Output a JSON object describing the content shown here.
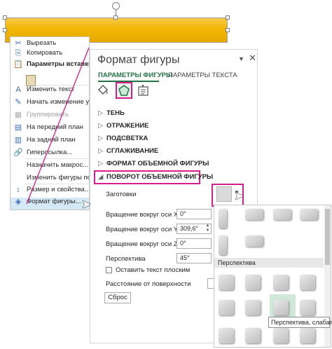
{
  "context_menu": {
    "items": [
      {
        "label": "Вырезать",
        "icon": "scissors-icon",
        "glyph": "✂",
        "disabled": false
      },
      {
        "label": "Копировать",
        "icon": "copy-icon",
        "glyph": "⎘",
        "disabled": false
      },
      {
        "label": "Параметры вставки:",
        "icon": "paste-icon",
        "glyph": "📋",
        "disabled": false,
        "bold": true
      },
      {
        "label": "Изменить текст",
        "icon": "edit-text-icon",
        "glyph": "A",
        "disabled": false
      },
      {
        "label": "Начать изменение узлов",
        "icon": "edit-points-icon",
        "glyph": "✎",
        "disabled": false
      },
      {
        "label": "Группировать",
        "icon": "group-icon",
        "glyph": "▦",
        "disabled": true
      },
      {
        "label": "На передний план",
        "icon": "bring-forward-icon",
        "glyph": "▤",
        "disabled": false
      },
      {
        "label": "На задний план",
        "icon": "send-backward-icon",
        "glyph": "▥",
        "disabled": false
      },
      {
        "label": "Гиперссылка...",
        "icon": "hyperlink-icon",
        "glyph": "🔗",
        "disabled": false
      },
      {
        "label": "Назначить макрос...",
        "icon": "",
        "glyph": "",
        "disabled": false
      },
      {
        "label": "Изменить фигуры по умолчанию",
        "icon": "",
        "glyph": "",
        "disabled": false
      },
      {
        "label": "Размер и свойства...",
        "icon": "size-properties-icon",
        "glyph": "↕",
        "disabled": false
      },
      {
        "label": "Формат фигуры...",
        "icon": "format-shape-icon",
        "glyph": "◈",
        "disabled": false
      }
    ]
  },
  "panel": {
    "title": "Формат фигуры",
    "tabs": [
      "ПАРАМЕТРЫ ФИГУРЫ",
      "ПАРАМЕТРЫ ТЕКСТА"
    ],
    "sections": [
      "ТЕНЬ",
      "ОТРАЖЕНИЕ",
      "ПОДСВЕТКА",
      "СГЛАЖИВАНИЕ",
      "ФОРМАТ ОБЪЕМНОЙ ФИГУРЫ",
      "ПОВОРОТ ОБЪЕМНОЙ ФИГУРЫ"
    ],
    "presets_label": "Заготовки",
    "rotation": {
      "x_label": "Вращение вокруг оси X",
      "x_value": "0°",
      "y_label": "Вращение вокруг оси Y",
      "y_value": "309,6°",
      "z_label": "Вращение вокруг оси Z",
      "z_value": "0°",
      "perspective_label": "Перспектива",
      "perspective_value": "45°"
    },
    "keep_flat_label": "Оставить текст плоским",
    "distance_label": "Расстояние от поверхности",
    "reset_label": "Сброс"
  },
  "gallery": {
    "category": "Перспектива",
    "tooltip": "Перспектива, слабая"
  },
  "colors": {
    "accent": "#217346",
    "highlight": "#d61f8c",
    "shape": "#f2b705"
  }
}
